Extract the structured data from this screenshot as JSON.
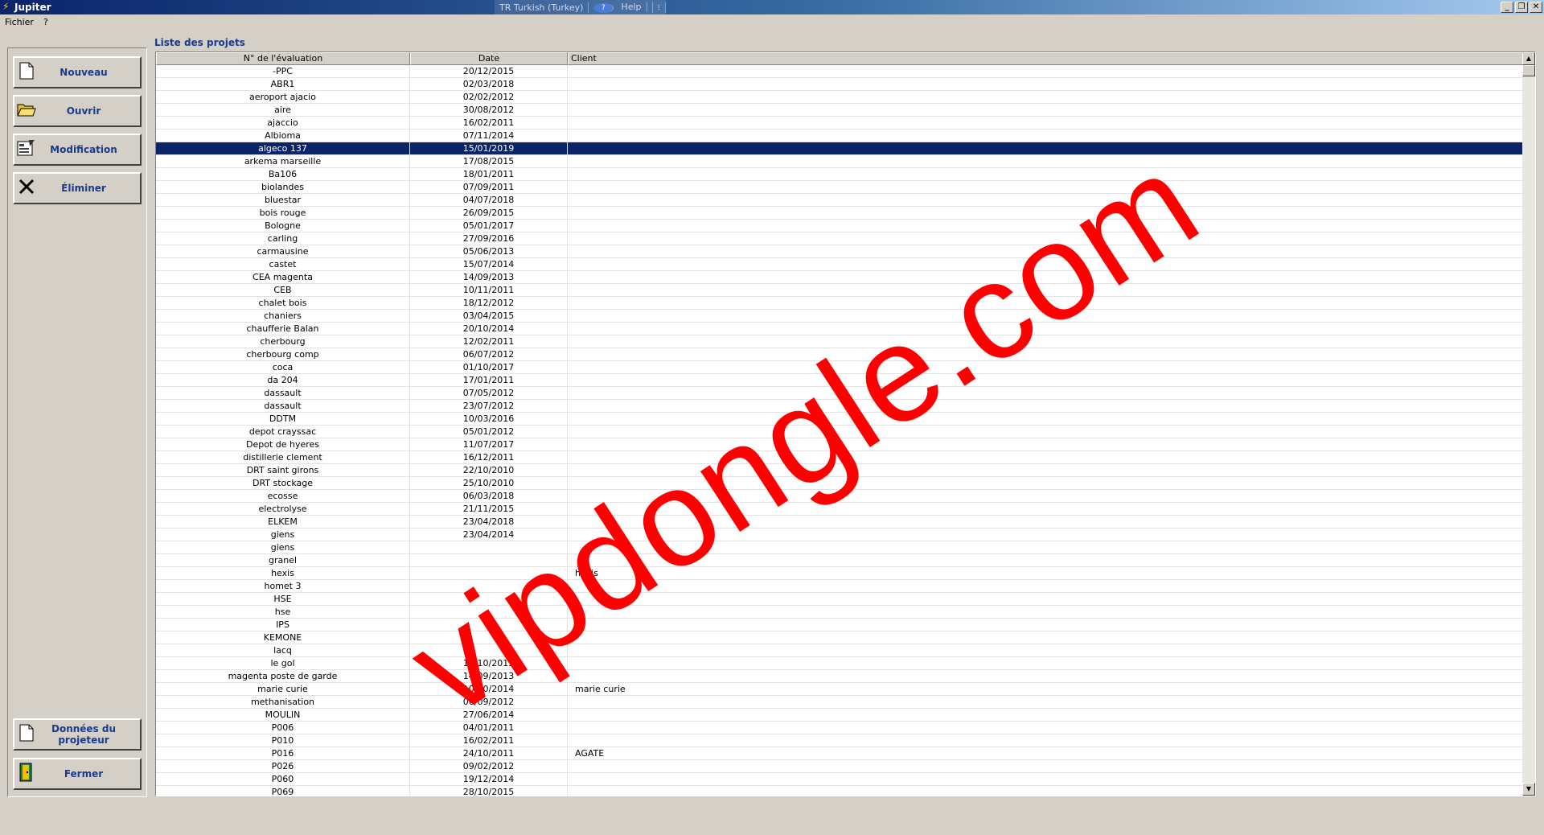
{
  "window": {
    "title": "Jupiter",
    "langbar": {
      "language": "TR Turkish (Turkey)",
      "help": "Help"
    }
  },
  "menu": [
    "Fichier",
    "?"
  ],
  "buttons": {
    "nouveau": "Nouveau",
    "ouvrir": "Ouvrir",
    "modification": "Modification",
    "eliminer": "Éliminer",
    "donnees": "Données du projeteur",
    "fermer": "Fermer"
  },
  "list": {
    "title": "Liste des projets",
    "columns": [
      "N° de l'évaluation",
      "Date",
      "Client"
    ],
    "selected_index": 6,
    "rows": [
      [
        "-PPC",
        "20/12/2015",
        ""
      ],
      [
        "ABR1",
        "02/03/2018",
        ""
      ],
      [
        "aeroport ajacio",
        "02/02/2012",
        ""
      ],
      [
        "aire",
        "30/08/2012",
        ""
      ],
      [
        "ajaccio",
        "16/02/2011",
        ""
      ],
      [
        "Albioma",
        "07/11/2014",
        ""
      ],
      [
        "algeco 137",
        "15/01/2019",
        ""
      ],
      [
        "arkema marseille",
        "17/08/2015",
        ""
      ],
      [
        "Ba106",
        "18/01/2011",
        ""
      ],
      [
        "biolandes",
        "07/09/2011",
        ""
      ],
      [
        "bluestar",
        "04/07/2018",
        ""
      ],
      [
        "bois rouge",
        "26/09/2015",
        ""
      ],
      [
        "Bologne",
        "05/01/2017",
        ""
      ],
      [
        "carling",
        "27/09/2016",
        ""
      ],
      [
        "carmausine",
        "05/06/2013",
        ""
      ],
      [
        "castet",
        "15/07/2014",
        ""
      ],
      [
        "CEA magenta",
        "14/09/2013",
        ""
      ],
      [
        "CEB",
        "10/11/2011",
        ""
      ],
      [
        "chalet bois",
        "18/12/2012",
        ""
      ],
      [
        "chaniers",
        "03/04/2015",
        ""
      ],
      [
        "chaufferie Balan",
        "20/10/2014",
        ""
      ],
      [
        "cherbourg",
        "12/02/2011",
        ""
      ],
      [
        "cherbourg comp",
        "06/07/2012",
        ""
      ],
      [
        "coca",
        "01/10/2017",
        ""
      ],
      [
        "da 204",
        "17/01/2011",
        ""
      ],
      [
        "dassault",
        "07/05/2012",
        ""
      ],
      [
        "dassault",
        "23/07/2012",
        ""
      ],
      [
        "DDTM",
        "10/03/2016",
        ""
      ],
      [
        "depot crayssac",
        "05/01/2012",
        ""
      ],
      [
        "Depot de hyeres",
        "11/07/2017",
        ""
      ],
      [
        "distillerie clement",
        "16/12/2011",
        ""
      ],
      [
        "DRT saint girons",
        "22/10/2010",
        ""
      ],
      [
        "DRT stockage",
        "25/10/2010",
        ""
      ],
      [
        "ecosse",
        "06/03/2018",
        ""
      ],
      [
        "electrolyse",
        "21/11/2015",
        ""
      ],
      [
        "ELKEM",
        "23/04/2018",
        ""
      ],
      [
        "giens",
        "23/04/2014",
        ""
      ],
      [
        "giens",
        "",
        ""
      ],
      [
        "granel",
        "",
        ""
      ],
      [
        "hexis",
        "",
        "hexis"
      ],
      [
        "homet 3",
        "",
        ""
      ],
      [
        "HSE",
        "",
        ""
      ],
      [
        "hse",
        "",
        ""
      ],
      [
        "IPS",
        "",
        ""
      ],
      [
        "KEMONE",
        "",
        ""
      ],
      [
        "lacq",
        "",
        ""
      ],
      [
        "le gol",
        "12/10/2015",
        ""
      ],
      [
        "magenta poste de garde",
        "14/09/2013",
        ""
      ],
      [
        "marie curie",
        "10/10/2014",
        "marie curie"
      ],
      [
        "methanisation",
        "06/09/2012",
        ""
      ],
      [
        "MOULIN",
        "27/06/2014",
        ""
      ],
      [
        "P006",
        "04/01/2011",
        ""
      ],
      [
        "P010",
        "16/02/2011",
        ""
      ],
      [
        "P016",
        "24/10/2011",
        "AGATE"
      ],
      [
        "P026",
        "09/02/2012",
        ""
      ],
      [
        "P060",
        "19/12/2014",
        ""
      ],
      [
        "P069",
        "28/10/2015",
        ""
      ]
    ]
  },
  "watermark": "vipdongle.com"
}
